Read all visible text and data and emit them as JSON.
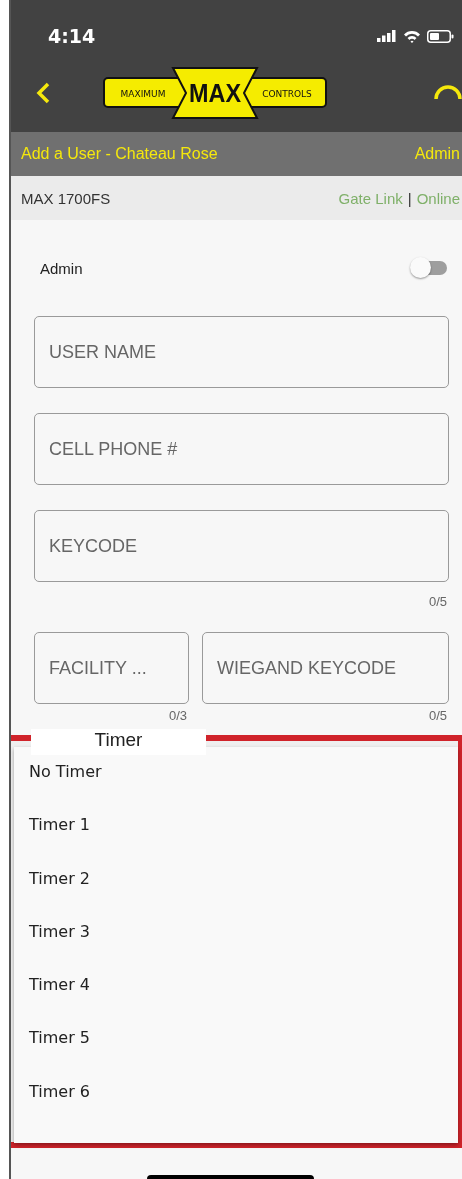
{
  "status_bar": {
    "time": "4:14"
  },
  "logo": {
    "left": "MAXIMUM",
    "center": "MAX",
    "right": "CONTROLS"
  },
  "header": {
    "title": "Add a User - Chateau Rose",
    "role": "Admin"
  },
  "device": {
    "name": "MAX 1700FS",
    "link": "Gate Link",
    "separator": "|",
    "status": "Online"
  },
  "admin_toggle": {
    "label": "Admin",
    "on": false
  },
  "fields": [
    {
      "placeholder": "USER NAME"
    },
    {
      "placeholder": "CELL PHONE #"
    },
    {
      "placeholder": "KEYCODE",
      "counter": "0/5"
    }
  ],
  "pair_fields": [
    {
      "placeholder": "FACILITY ...",
      "counter": "0/3"
    },
    {
      "placeholder": "WIEGAND KEYCODE",
      "counter": "0/5"
    }
  ],
  "timer_menu": {
    "label": "Timer",
    "options": [
      {
        "label": "No Timer"
      },
      {
        "label": "Timer 1"
      },
      {
        "label": "Timer 2"
      },
      {
        "label": "Timer 3"
      },
      {
        "label": "Timer 4"
      },
      {
        "label": "Timer 5"
      },
      {
        "label": "Timer 6"
      }
    ]
  }
}
